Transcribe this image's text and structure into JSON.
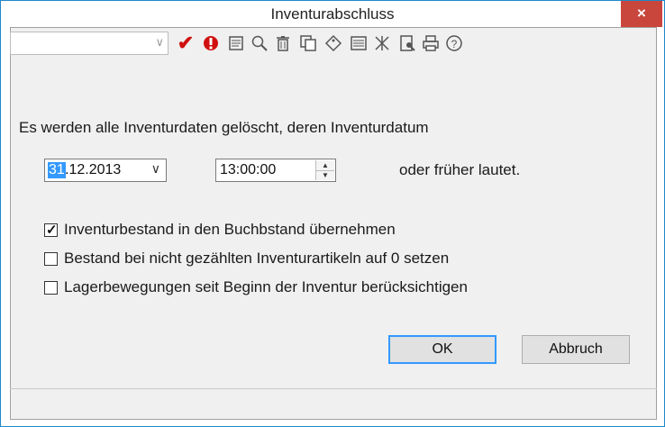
{
  "window": {
    "title": "Inventurabschluss",
    "close_label": "×",
    "accent_color": "#c9463d",
    "border_color": "#1e88c8"
  },
  "toolbar": {
    "combo_value": "",
    "icons": [
      "dropdown-arrow-icon",
      "checkmark-icon",
      "stop-icon",
      "notepad-icon",
      "search-icon",
      "trash-icon",
      "copy-icon",
      "tag-icon",
      "list-icon",
      "filter-icon",
      "preview-icon",
      "print-icon",
      "help-icon"
    ]
  },
  "main": {
    "intro": "Es werden alle Inventurdaten gelöscht, deren Inventurdatum",
    "date_day": "31",
    "date_rest": ".12.2013",
    "time_value": "13:00:00",
    "suffix": "oder früher lautet."
  },
  "options": [
    {
      "label": "Inventurbestand in den Buchbstand übernehmen",
      "checked": true
    },
    {
      "label": "Bestand bei nicht gezählten Inventurartikeln auf 0 setzen",
      "checked": false
    },
    {
      "label": "Lagerbewegungen seit Beginn der Inventur berücksichtigen",
      "checked": false
    }
  ],
  "buttons": {
    "ok": "OK",
    "cancel": "Abbruch"
  }
}
